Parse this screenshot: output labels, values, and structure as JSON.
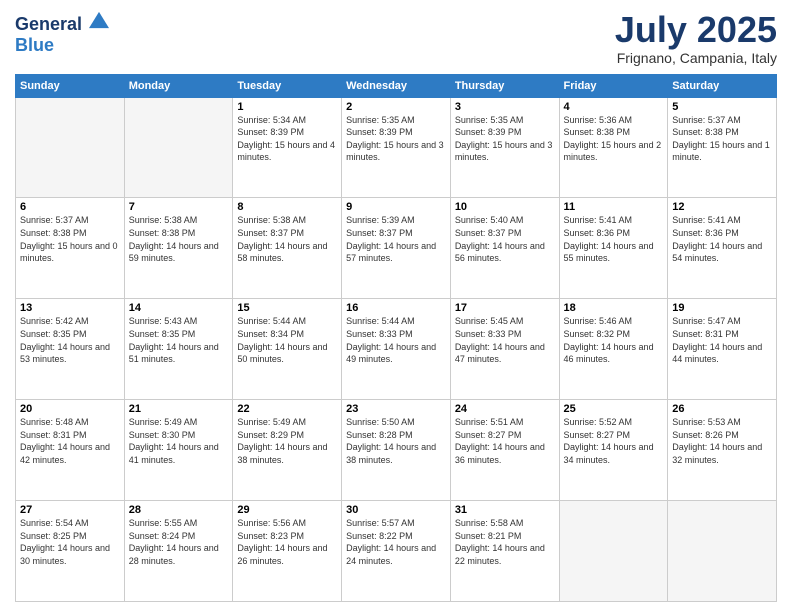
{
  "header": {
    "logo_line1": "General",
    "logo_line2": "Blue",
    "month": "July 2025",
    "location": "Frignano, Campania, Italy"
  },
  "weekdays": [
    "Sunday",
    "Monday",
    "Tuesday",
    "Wednesday",
    "Thursday",
    "Friday",
    "Saturday"
  ],
  "weeks": [
    [
      {
        "day": "",
        "sunrise": "",
        "sunset": "",
        "daylight": ""
      },
      {
        "day": "",
        "sunrise": "",
        "sunset": "",
        "daylight": ""
      },
      {
        "day": "1",
        "sunrise": "Sunrise: 5:34 AM",
        "sunset": "Sunset: 8:39 PM",
        "daylight": "Daylight: 15 hours and 4 minutes."
      },
      {
        "day": "2",
        "sunrise": "Sunrise: 5:35 AM",
        "sunset": "Sunset: 8:39 PM",
        "daylight": "Daylight: 15 hours and 3 minutes."
      },
      {
        "day": "3",
        "sunrise": "Sunrise: 5:35 AM",
        "sunset": "Sunset: 8:39 PM",
        "daylight": "Daylight: 15 hours and 3 minutes."
      },
      {
        "day": "4",
        "sunrise": "Sunrise: 5:36 AM",
        "sunset": "Sunset: 8:38 PM",
        "daylight": "Daylight: 15 hours and 2 minutes."
      },
      {
        "day": "5",
        "sunrise": "Sunrise: 5:37 AM",
        "sunset": "Sunset: 8:38 PM",
        "daylight": "Daylight: 15 hours and 1 minute."
      }
    ],
    [
      {
        "day": "6",
        "sunrise": "Sunrise: 5:37 AM",
        "sunset": "Sunset: 8:38 PM",
        "daylight": "Daylight: 15 hours and 0 minutes."
      },
      {
        "day": "7",
        "sunrise": "Sunrise: 5:38 AM",
        "sunset": "Sunset: 8:38 PM",
        "daylight": "Daylight: 14 hours and 59 minutes."
      },
      {
        "day": "8",
        "sunrise": "Sunrise: 5:38 AM",
        "sunset": "Sunset: 8:37 PM",
        "daylight": "Daylight: 14 hours and 58 minutes."
      },
      {
        "day": "9",
        "sunrise": "Sunrise: 5:39 AM",
        "sunset": "Sunset: 8:37 PM",
        "daylight": "Daylight: 14 hours and 57 minutes."
      },
      {
        "day": "10",
        "sunrise": "Sunrise: 5:40 AM",
        "sunset": "Sunset: 8:37 PM",
        "daylight": "Daylight: 14 hours and 56 minutes."
      },
      {
        "day": "11",
        "sunrise": "Sunrise: 5:41 AM",
        "sunset": "Sunset: 8:36 PM",
        "daylight": "Daylight: 14 hours and 55 minutes."
      },
      {
        "day": "12",
        "sunrise": "Sunrise: 5:41 AM",
        "sunset": "Sunset: 8:36 PM",
        "daylight": "Daylight: 14 hours and 54 minutes."
      }
    ],
    [
      {
        "day": "13",
        "sunrise": "Sunrise: 5:42 AM",
        "sunset": "Sunset: 8:35 PM",
        "daylight": "Daylight: 14 hours and 53 minutes."
      },
      {
        "day": "14",
        "sunrise": "Sunrise: 5:43 AM",
        "sunset": "Sunset: 8:35 PM",
        "daylight": "Daylight: 14 hours and 51 minutes."
      },
      {
        "day": "15",
        "sunrise": "Sunrise: 5:44 AM",
        "sunset": "Sunset: 8:34 PM",
        "daylight": "Daylight: 14 hours and 50 minutes."
      },
      {
        "day": "16",
        "sunrise": "Sunrise: 5:44 AM",
        "sunset": "Sunset: 8:33 PM",
        "daylight": "Daylight: 14 hours and 49 minutes."
      },
      {
        "day": "17",
        "sunrise": "Sunrise: 5:45 AM",
        "sunset": "Sunset: 8:33 PM",
        "daylight": "Daylight: 14 hours and 47 minutes."
      },
      {
        "day": "18",
        "sunrise": "Sunrise: 5:46 AM",
        "sunset": "Sunset: 8:32 PM",
        "daylight": "Daylight: 14 hours and 46 minutes."
      },
      {
        "day": "19",
        "sunrise": "Sunrise: 5:47 AM",
        "sunset": "Sunset: 8:31 PM",
        "daylight": "Daylight: 14 hours and 44 minutes."
      }
    ],
    [
      {
        "day": "20",
        "sunrise": "Sunrise: 5:48 AM",
        "sunset": "Sunset: 8:31 PM",
        "daylight": "Daylight: 14 hours and 42 minutes."
      },
      {
        "day": "21",
        "sunrise": "Sunrise: 5:49 AM",
        "sunset": "Sunset: 8:30 PM",
        "daylight": "Daylight: 14 hours and 41 minutes."
      },
      {
        "day": "22",
        "sunrise": "Sunrise: 5:49 AM",
        "sunset": "Sunset: 8:29 PM",
        "daylight": "Daylight: 14 hours and 38 minutes."
      },
      {
        "day": "23",
        "sunrise": "Sunrise: 5:50 AM",
        "sunset": "Sunset: 8:28 PM",
        "daylight": "Daylight: 14 hours and 38 minutes."
      },
      {
        "day": "24",
        "sunrise": "Sunrise: 5:51 AM",
        "sunset": "Sunset: 8:27 PM",
        "daylight": "Daylight: 14 hours and 36 minutes."
      },
      {
        "day": "25",
        "sunrise": "Sunrise: 5:52 AM",
        "sunset": "Sunset: 8:27 PM",
        "daylight": "Daylight: 14 hours and 34 minutes."
      },
      {
        "day": "26",
        "sunrise": "Sunrise: 5:53 AM",
        "sunset": "Sunset: 8:26 PM",
        "daylight": "Daylight: 14 hours and 32 minutes."
      }
    ],
    [
      {
        "day": "27",
        "sunrise": "Sunrise: 5:54 AM",
        "sunset": "Sunset: 8:25 PM",
        "daylight": "Daylight: 14 hours and 30 minutes."
      },
      {
        "day": "28",
        "sunrise": "Sunrise: 5:55 AM",
        "sunset": "Sunset: 8:24 PM",
        "daylight": "Daylight: 14 hours and 28 minutes."
      },
      {
        "day": "29",
        "sunrise": "Sunrise: 5:56 AM",
        "sunset": "Sunset: 8:23 PM",
        "daylight": "Daylight: 14 hours and 26 minutes."
      },
      {
        "day": "30",
        "sunrise": "Sunrise: 5:57 AM",
        "sunset": "Sunset: 8:22 PM",
        "daylight": "Daylight: 14 hours and 24 minutes."
      },
      {
        "day": "31",
        "sunrise": "Sunrise: 5:58 AM",
        "sunset": "Sunset: 8:21 PM",
        "daylight": "Daylight: 14 hours and 22 minutes."
      },
      {
        "day": "",
        "sunrise": "",
        "sunset": "",
        "daylight": ""
      },
      {
        "day": "",
        "sunrise": "",
        "sunset": "",
        "daylight": ""
      }
    ]
  ]
}
